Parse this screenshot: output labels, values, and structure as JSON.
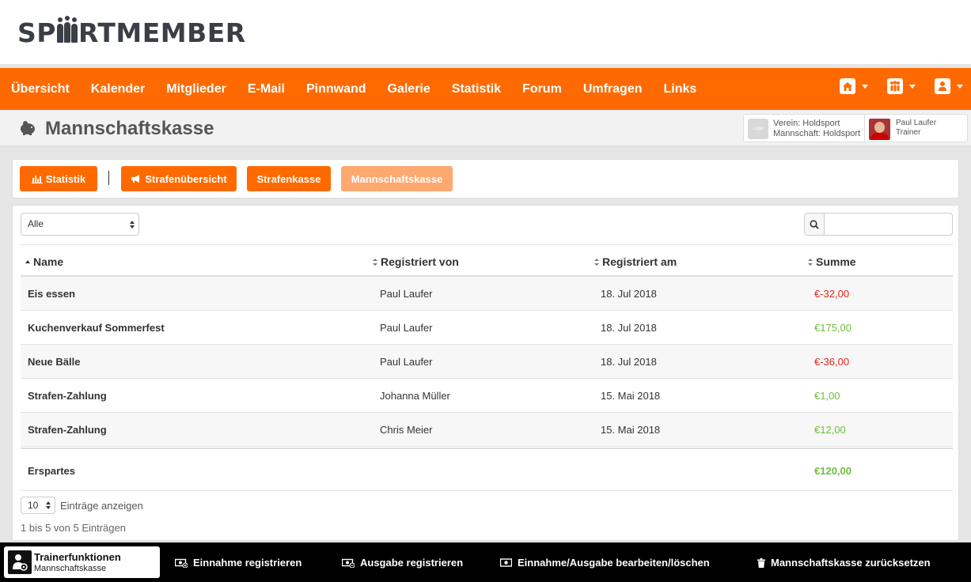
{
  "brand": {
    "logo_prefix": "SP",
    "logo_suffix": "RTMEMBER"
  },
  "nav": {
    "items": [
      "Übersicht",
      "Kalender",
      "Mitglieder",
      "E-Mail",
      "Pinnwand",
      "Galerie",
      "Statistik",
      "Forum",
      "Umfragen",
      "Links"
    ],
    "icons": [
      "home-icon",
      "team-icon",
      "user-icon"
    ]
  },
  "page": {
    "title": "Mannschaftskasse",
    "icon": "piggy-bank-icon"
  },
  "club": {
    "logo_text": "Logo",
    "verein": "Verein: Holdsport",
    "mannschaft": "Mannschaft: Holdsport",
    "user_name": "Paul Laufer",
    "user_role": "Trainer"
  },
  "tabs": {
    "statistik": "Statistik",
    "strafenuebersicht": "Strafenübersicht",
    "strafenkasse": "Strafenkasse",
    "mannschaftskasse": "Mannschaftskasse"
  },
  "filter": {
    "selected": "Alle"
  },
  "search": {
    "value": ""
  },
  "table": {
    "headers": {
      "name": "Name",
      "von": "Registriert von",
      "am": "Registriert am",
      "summe": "Summe"
    },
    "rows": [
      {
        "name": "Eis essen",
        "von": "Paul Laufer",
        "am": "18. Jul 2018",
        "summe": "€-32,00"
      },
      {
        "name": "Kuchenverkauf Sommerfest",
        "von": "Paul Laufer",
        "am": "18. Jul 2018",
        "summe": "€175,00"
      },
      {
        "name": "Neue Bälle",
        "von": "Paul Laufer",
        "am": "18. Jul 2018",
        "summe": "€-36,00"
      },
      {
        "name": "Strafen-Zahlung",
        "von": "Johanna Müller",
        "am": "15. Mai 2018",
        "summe": "€1,00"
      },
      {
        "name": "Strafen-Zahlung",
        "von": "Chris Meier",
        "am": "15. Mai 2018",
        "summe": "€12,00"
      }
    ],
    "total": {
      "label": "Erspartes",
      "summe": "€120,00"
    }
  },
  "length": {
    "value": "10",
    "label": "Einträge anzeigen"
  },
  "info": "1 bis 5 von 5 Einträgen",
  "trainer": {
    "title": "Trainerfunktionen",
    "sub": "Mannschaftskasse"
  },
  "actions": {
    "einnahme": "Einnahme registrieren",
    "ausgabe": "Ausgabe registrieren",
    "bearbeiten": "Einnahme/Ausgabe bearbeiten/löschen",
    "reset": "Mannschaftskasse zurücksetzen"
  },
  "colors": {
    "accent": "#ff6a00",
    "negative": "#e0261b",
    "positive": "#6cbf3a"
  }
}
